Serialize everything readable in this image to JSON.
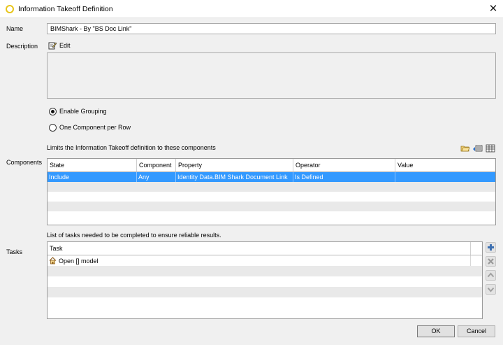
{
  "window": {
    "title": "Information Takeoff Definition",
    "close_glyph": "✕"
  },
  "name_field": {
    "label": "Name",
    "value": "BIMShark - By \"BS Doc Link\""
  },
  "description": {
    "label": "Description",
    "edit_label": "Edit",
    "value": ""
  },
  "grouping": {
    "options": [
      {
        "label": "Enable Grouping",
        "selected": true
      },
      {
        "label": "One Component per Row",
        "selected": false
      }
    ]
  },
  "components": {
    "label": "Components",
    "caption": "Limits the Information Takeoff definition to these components",
    "columns": [
      "State",
      "Component",
      "Property",
      "Operator",
      "Value"
    ],
    "rows": [
      {
        "state": "Include",
        "component": "Any",
        "property": "Identity Data.BIM Shark Document Link",
        "operator": "Is Defined",
        "value": ""
      }
    ],
    "toolbar_icons": [
      "open-folder-icon",
      "list-edit-icon",
      "table-grid-icon"
    ]
  },
  "tasks": {
    "label": "Tasks",
    "caption": "List of tasks needed to be completed to ensure reliable results.",
    "column": "Task",
    "rows": [
      {
        "icon": "house-icon",
        "text": "Open [] model"
      }
    ],
    "side_buttons": [
      "add-icon",
      "delete-icon",
      "move-up-icon",
      "move-down-icon"
    ]
  },
  "footer": {
    "ok_label": "OK",
    "cancel_label": "Cancel"
  },
  "colors": {
    "selection": "#3399ff",
    "accent_yellow": "#e8c51b",
    "background": "#f0f0f0"
  }
}
